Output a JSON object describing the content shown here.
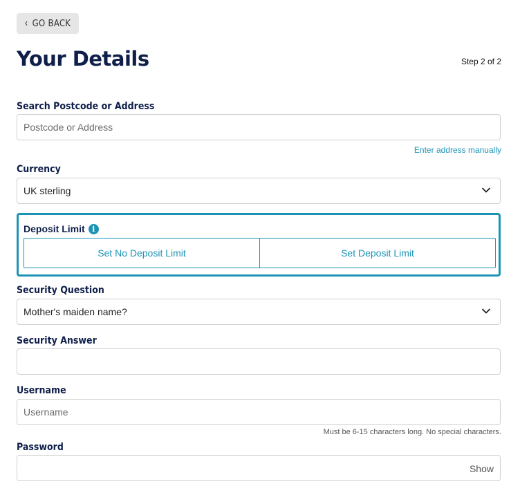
{
  "header": {
    "back_label": "GO BACK",
    "title": "Your Details",
    "step": "Step 2 of 2"
  },
  "address": {
    "label": "Search Postcode or Address",
    "placeholder": "Postcode or Address",
    "manual_link": "Enter address manually"
  },
  "currency": {
    "label": "Currency",
    "value": "UK sterling"
  },
  "deposit": {
    "label": "Deposit Limit",
    "info_icon": "i",
    "option_none": "Set No Deposit Limit",
    "option_set": "Set Deposit Limit"
  },
  "security_question": {
    "label": "Security Question",
    "value": "Mother's maiden name?"
  },
  "security_answer": {
    "label": "Security Answer",
    "value": ""
  },
  "username": {
    "label": "Username",
    "placeholder": "Username",
    "hint": "Must be 6-15 characters long. No special characters."
  },
  "password": {
    "label": "Password",
    "show_label": "Show"
  },
  "colors": {
    "accent": "#1c93b5",
    "heading": "#0f1f4a",
    "border": "#cfcfcf"
  },
  "icons": {
    "back": "chevron-left-icon",
    "dropdown": "chevron-down-icon",
    "info": "info-icon"
  }
}
